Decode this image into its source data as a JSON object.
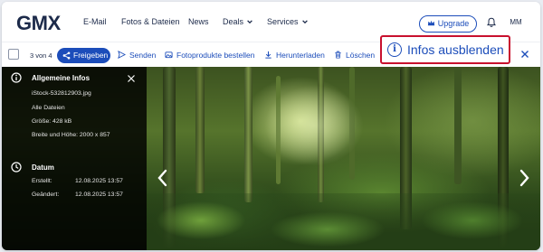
{
  "header": {
    "logo": "GMX",
    "nav": [
      {
        "label": "E-Mail",
        "dropdown": false
      },
      {
        "label": "Fotos & Dateien",
        "dropdown": false
      },
      {
        "label": "News",
        "dropdown": false
      },
      {
        "label": "Deals",
        "dropdown": true
      },
      {
        "label": "Services",
        "dropdown": true
      }
    ],
    "upgrade_label": "Upgrade",
    "avatar_initials": "MM"
  },
  "toolbar": {
    "count": "3 von 4",
    "share_label": "Freigeben",
    "send_label": "Senden",
    "photo_products_label": "Fotoprodukte bestellen",
    "download_label": "Herunterladen",
    "delete_label": "Löschen",
    "infos_label": "Infos ausblenden"
  },
  "info_panel": {
    "general_title": "Allgemeine Infos",
    "filename": "iStock-532812903.jpg",
    "folder": "Alle Dateien",
    "size": "Größe: 428 kB",
    "dimensions": "Breite und Höhe: 2000 x 857",
    "date_title": "Datum",
    "created_label": "Erstellt:",
    "created_value": "12.08.2025 13:57",
    "modified_label": "Geändert:",
    "modified_value": "12.08.2025 13:57"
  },
  "colors": {
    "brand_blue": "#1c4dba",
    "navy": "#1c2a4a",
    "highlight_red": "#c8102e"
  }
}
